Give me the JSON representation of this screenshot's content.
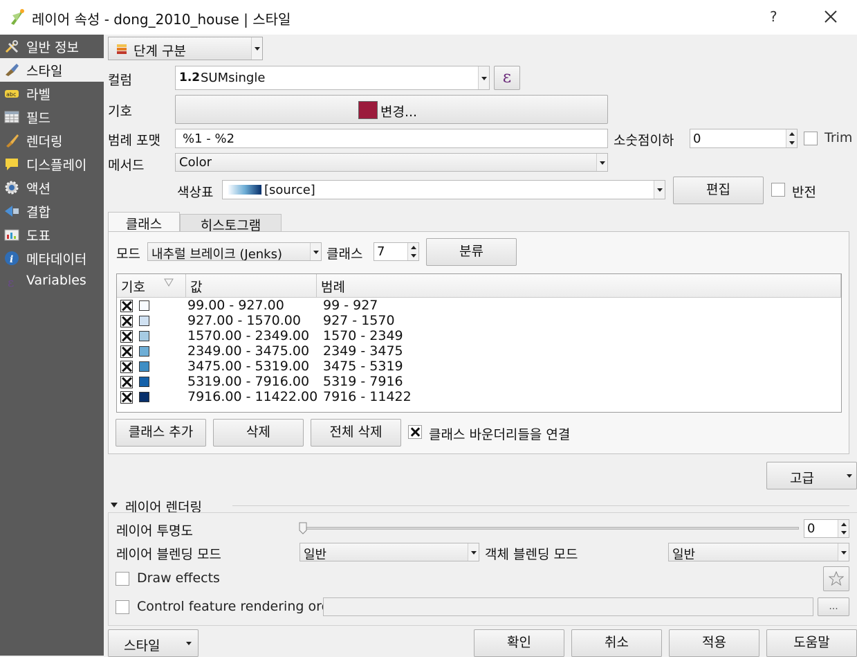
{
  "window": {
    "title": "레이어 속성 - dong_2010_house | 스타일",
    "help": "?"
  },
  "sidebar": {
    "items": [
      {
        "label": "일반 정보",
        "icon": "tools-icon"
      },
      {
        "label": "스타일",
        "icon": "paintbrush-icon"
      },
      {
        "label": "라벨",
        "icon": "abc-label-icon"
      },
      {
        "label": "필드",
        "icon": "table-icon"
      },
      {
        "label": "렌더링",
        "icon": "brush-icon"
      },
      {
        "label": "디스플레이",
        "icon": "speech-bubble-icon"
      },
      {
        "label": "액션",
        "icon": "gear-run-icon"
      },
      {
        "label": "결합",
        "icon": "join-icon"
      },
      {
        "label": "도표",
        "icon": "chart-icon"
      },
      {
        "label": "메타데이터",
        "icon": "info-icon"
      },
      {
        "label": "Variables",
        "icon": "epsilon-icon"
      }
    ]
  },
  "renderer": {
    "type": "단계 구분",
    "column_label": "컬럼",
    "column_type": "1.2",
    "column_value": "SUMsingle",
    "expression_glyph": "ε",
    "symbol_label": "기호",
    "symbol_button": "변경...",
    "symbol_color": "#9b1b3c",
    "legend_format_label": "범례 포맷",
    "legend_format_value": "%1 - %2",
    "precision_label": "소숫점이하",
    "precision_value": "0",
    "trim_label": "Trim",
    "method_label": "메서드",
    "method_value": "Color",
    "ramp_label": "색상표",
    "ramp_value": "[source]",
    "edit_button": "편집",
    "invert_label": "반전"
  },
  "tabs": [
    {
      "label": "클래스",
      "active": true
    },
    {
      "label": "히스토그램",
      "active": false
    }
  ],
  "classes": {
    "mode_label": "모드",
    "mode_value": "내추럴 브레이크 (Jenks)",
    "count_label": "클래스",
    "count_value": "7",
    "classify_button": "분류",
    "headers": [
      "기호",
      "값",
      "범례"
    ],
    "rows": [
      {
        "value": "99.00 - 927.00",
        "legend": "99 - 927",
        "color": "#f7fbff"
      },
      {
        "value": "927.00 - 1570.00",
        "legend": "927 - 1570",
        "color": "#d0e1f2"
      },
      {
        "value": "1570.00 - 2349.00",
        "legend": "1570 - 2349",
        "color": "#a6cbe3"
      },
      {
        "value": "2349.00 - 3475.00",
        "legend": "2349 - 3475",
        "color": "#6eaed6"
      },
      {
        "value": "3475.00 - 5319.00",
        "legend": "3475 - 5319",
        "color": "#3e8ec4"
      },
      {
        "value": "5319.00 - 7916.00",
        "legend": "5319 - 7916",
        "color": "#1561a9"
      },
      {
        "value": "7916.00 - 11422.00",
        "legend": "7916 - 11422",
        "color": "#08306b"
      }
    ],
    "add_button": "클래스 추가",
    "delete_button": "삭제",
    "delete_all_button": "전체 삭제",
    "link_boundaries_label": "클래스 바운더리들을 연결",
    "link_boundaries_checked": true
  },
  "advanced_button": "고급",
  "layer_rendering": {
    "section_label": "레이어 렌더링",
    "transparency_label": "레이어 투명도",
    "transparency_value": "0",
    "blend_label": "레이어 블렌딩 모드",
    "blend_value": "일반",
    "feature_blend_label": "객체 블렌딩 모드",
    "feature_blend_value": "일반",
    "draw_effects_label": "Draw effects",
    "order_label": "Control feature rendering order",
    "order_button": "..."
  },
  "footer": {
    "style_button": "스타일",
    "ok_button": "확인",
    "cancel_button": "취소",
    "apply_button": "적용",
    "help_button": "도움말"
  }
}
